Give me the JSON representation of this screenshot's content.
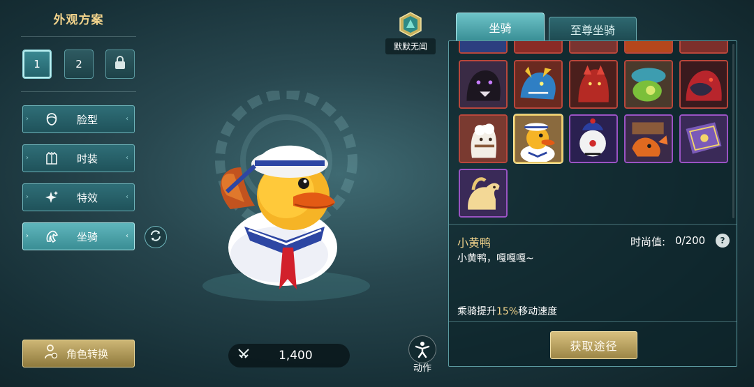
{
  "left_panel": {
    "title": "外观方案",
    "slots": [
      "1",
      "2"
    ],
    "menu": [
      {
        "label": "脸型",
        "icon": "face-icon"
      },
      {
        "label": "时装",
        "icon": "outfit-icon"
      },
      {
        "label": "特效",
        "icon": "sparkle-icon"
      },
      {
        "label": "坐骑",
        "icon": "mount-icon"
      }
    ],
    "active_menu": "坐骑",
    "role_switch_label": "角色转换"
  },
  "player": {
    "name": "默默无闻"
  },
  "power": {
    "value": "1,400"
  },
  "action": {
    "label": "动作"
  },
  "tabs": {
    "mount": "坐骑",
    "supreme_mount": "至尊坐骑"
  },
  "selected_mount": {
    "name": "小黄鸭",
    "fashion_label": "时尚值:",
    "fashion_value": "0/200",
    "help": "?",
    "description": "小黄鸭，嘎嘎嘎~",
    "bonus_prefix": "乘骑提升",
    "bonus_value": "15%",
    "bonus_suffix": "移动速度"
  },
  "obtain_label": "获取途径",
  "colors": {
    "accent_gold": "#f3d48c",
    "tab_active": "#4fa6ad",
    "rarity_red": "#b9473c",
    "rarity_purple": "#9a53c4"
  }
}
